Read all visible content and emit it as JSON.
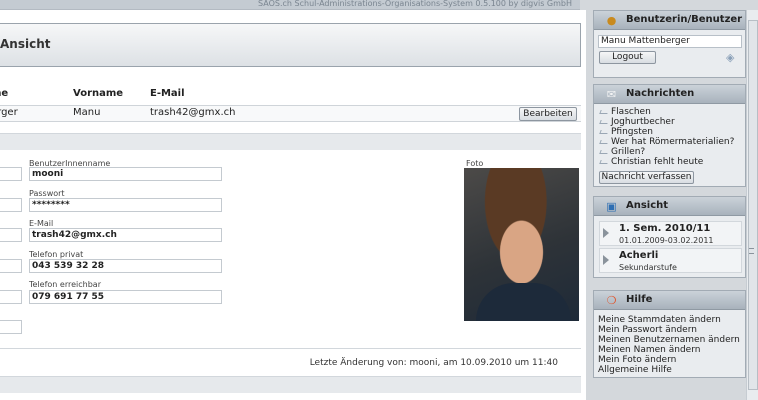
{
  "app": {
    "system_title": "SAOS.ch Schul-Administrations-Organisations-System 0.5.100 by digvis GmbH"
  },
  "header": {
    "title": "Ansicht"
  },
  "table": {
    "columns": [
      "me",
      "Vorname",
      "E-Mail"
    ],
    "row": {
      "name": "erger",
      "vorname": "Manu",
      "email": "trash42@gmx.ch",
      "edit_label": "Bearbeiten"
    }
  },
  "form": {
    "username": {
      "label": "BenutzerInnenname",
      "value": "mooni"
    },
    "password": {
      "label": "Passwort",
      "value": "********"
    },
    "email": {
      "label": "E-Mail",
      "value": "trash42@gmx.ch"
    },
    "phone_private": {
      "label": "Telefon privat",
      "value": "043 539 32 28"
    },
    "phone_reachable": {
      "label": "Telefon erreichbar",
      "value": "079 691 77 55"
    },
    "photo_label": "Foto"
  },
  "last_change": "Letzte Änderung von: mooni, am 10.09.2010 um 11:40",
  "sidebar": {
    "user": {
      "title": "Benutzerin/Benutzer",
      "name": "Manu Mattenberger",
      "logout_label": "Logout",
      "icon": "user-icon"
    },
    "messages": {
      "title": "Nachrichten",
      "icon": "envelope-icon",
      "items": [
        "Flaschen",
        "Joghurtbecher",
        "Pfingsten",
        "Wer hat Römermaterialien?",
        "Grillen?",
        "Christian fehlt heute"
      ],
      "compose_label": "Nachricht verfassen"
    },
    "view": {
      "title": "Ansicht",
      "icon": "monitor-icon",
      "items": [
        {
          "line1": "1. Sem. 2010/11",
          "line2": "01.01.2009-03.02.2011"
        },
        {
          "line1": "Acherli",
          "line2": "Sekundarstufe"
        }
      ]
    },
    "help": {
      "title": "Hilfe",
      "icon": "lifebuoy-icon",
      "items": [
        "Meine Stammdaten ändern",
        "Mein Passwort ändern",
        "Meinen Benutzernamen ändern",
        "Meinen Namen ändern",
        "Mein Foto ändern",
        "Allgemeine Hilfe"
      ]
    }
  },
  "colors": {
    "background": "#d4d8dc",
    "panel_header": "#a8b2bc",
    "content": "#ffffff"
  }
}
